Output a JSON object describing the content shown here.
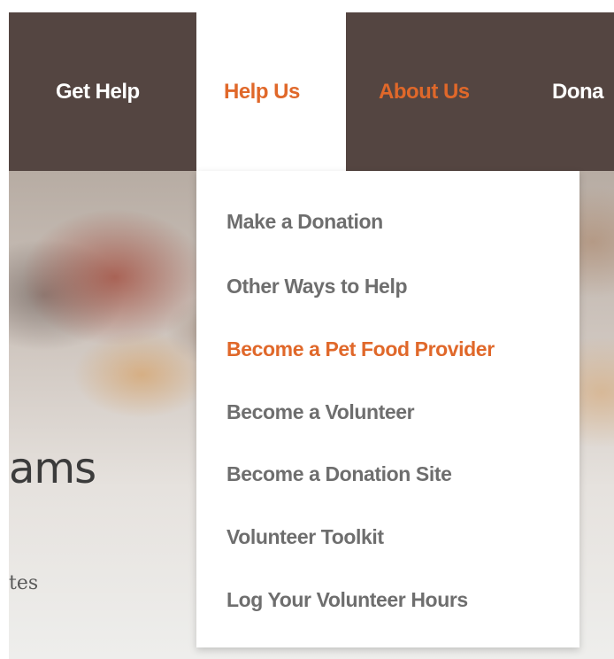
{
  "colors": {
    "nav_background": "#544541",
    "accent": "#e0682a",
    "menu_text": "#6e6e6e",
    "nav_text": "#ffffff"
  },
  "nav": {
    "items": [
      {
        "label": "Get Help"
      },
      {
        "label": "Help Us",
        "state": "open"
      },
      {
        "label": "About Us"
      },
      {
        "label": "Dona"
      }
    ]
  },
  "dropdown": {
    "items": [
      {
        "label": "Make a Donation"
      },
      {
        "label": "Other Ways to Help"
      },
      {
        "label": "Become a Pet Food Provider",
        "state": "hover"
      },
      {
        "label": "Become a Volunteer"
      },
      {
        "label": "Become a Donation Site"
      },
      {
        "label": "Volunteer Toolkit"
      },
      {
        "label": "Log Your Volunteer Hours"
      }
    ]
  },
  "hero": {
    "title_fragment": "ams",
    "subtitle_fragment": "tes"
  }
}
